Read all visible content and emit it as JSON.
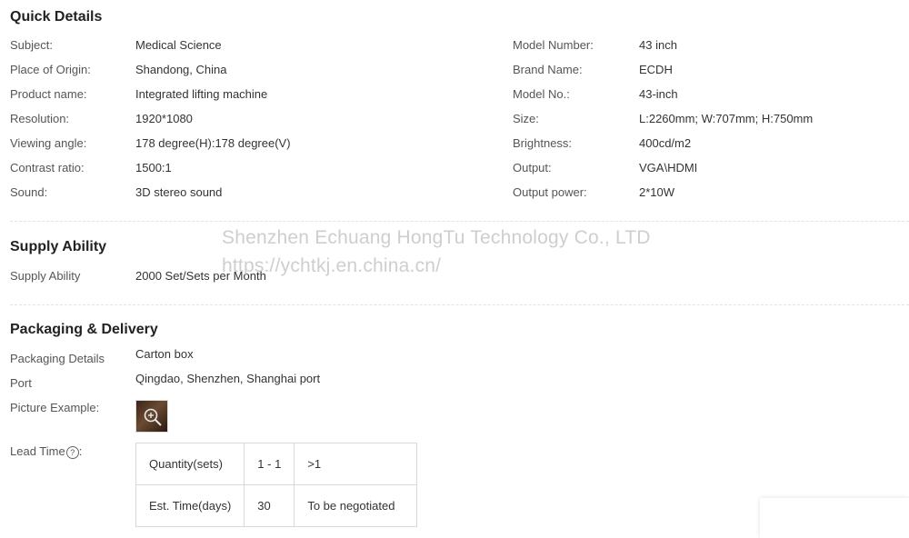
{
  "quick_details": {
    "title": "Quick Details",
    "left": [
      {
        "label": "Subject:",
        "value": "Medical Science"
      },
      {
        "label": "Place of Origin:",
        "value": "Shandong, China"
      },
      {
        "label": "Product name:",
        "value": "Integrated lifting machine"
      },
      {
        "label": "Resolution:",
        "value": "1920*1080"
      },
      {
        "label": "Viewing angle:",
        "value": "178 degree(H):178 degree(V)"
      },
      {
        "label": "Contrast ratio:",
        "value": "1500:1"
      },
      {
        "label": "Sound:",
        "value": "3D stereo sound"
      }
    ],
    "right": [
      {
        "label": "Model Number:",
        "value": "43 inch"
      },
      {
        "label": "Brand Name:",
        "value": "ECDH"
      },
      {
        "label": "Model No.:",
        "value": "43-inch"
      },
      {
        "label": "Size:",
        "value": "L:2260mm; W:707mm; H:750mm"
      },
      {
        "label": "Brightness:",
        "value": "400cd/m2"
      },
      {
        "label": "Output:",
        "value": "VGA\\HDMI"
      },
      {
        "label": "Output power:",
        "value": "2*10W"
      }
    ]
  },
  "supply_ability": {
    "title": "Supply Ability",
    "label": "Supply Ability",
    "value": "2000 Set/Sets per Month"
  },
  "watermark": {
    "line1": "Shenzhen Echuang HongTu Technology Co., LTD",
    "line2": "https://ychtkj.en.china.cn/"
  },
  "packaging": {
    "title": "Packaging & Delivery",
    "details_label": "Packaging Details",
    "details_value": "Carton box",
    "port_label": "Port",
    "port_value": "Qingdao, Shenzhen, Shanghai port",
    "picture_label": "Picture Example:",
    "lead_time_label": "Lead Time",
    "lead_time_suffix": ":",
    "help_glyph": "?",
    "lead_table": {
      "row1": [
        "Quantity(sets)",
        "1 - 1",
        ">1"
      ],
      "row2": [
        "Est. Time(days)",
        "30",
        "To be negotiated"
      ]
    }
  }
}
